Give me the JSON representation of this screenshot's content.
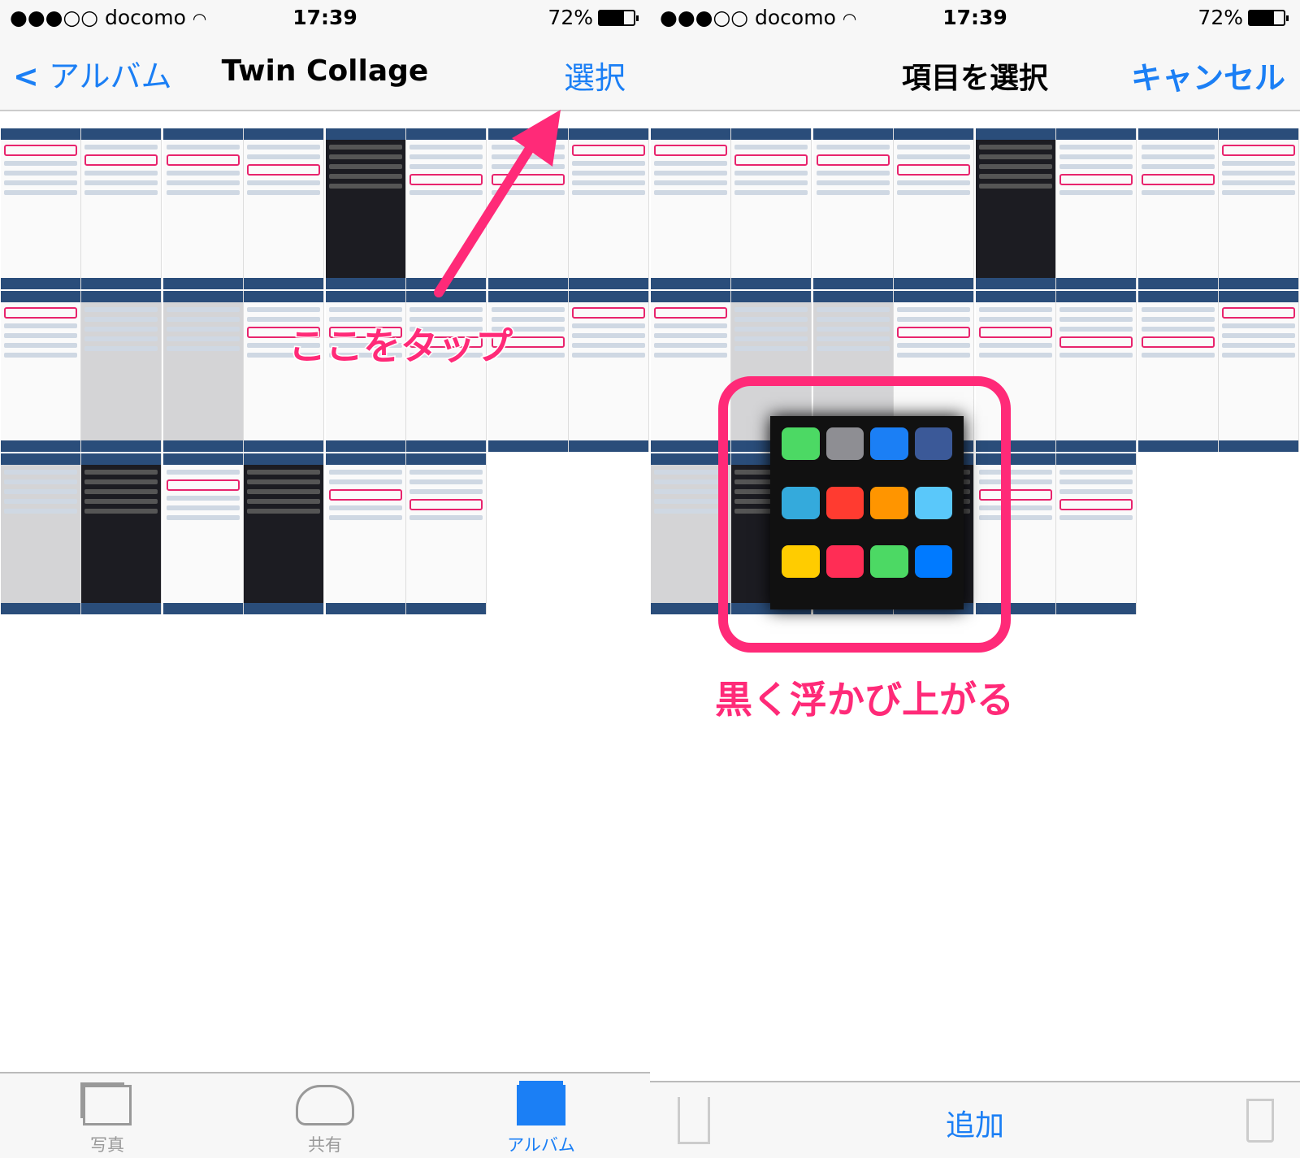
{
  "status": {
    "carrier": "●●●○○ docomo",
    "time": "17:39",
    "battery": "72%",
    "battery_level": 0.72
  },
  "left": {
    "nav": {
      "back": "アルバム",
      "title": "Twin Collage",
      "select": "選択"
    },
    "tabs": [
      {
        "label": "写真",
        "icon": "photos-icon",
        "active": false
      },
      {
        "label": "共有",
        "icon": "cloud-icon",
        "active": false
      },
      {
        "label": "アルバム",
        "icon": "album-icon",
        "active": true
      }
    ],
    "annotation": "ここをタップ"
  },
  "right": {
    "nav": {
      "title": "項目を選択",
      "cancel": "キャンセル"
    },
    "toolbar": {
      "share_icon": "share-icon",
      "add": "追加",
      "trash_icon": "trash-icon"
    },
    "annotation": "黒く浮かび上がる"
  },
  "colors": {
    "accent": "#1b7ff5",
    "annotation": "#ff2a78"
  },
  "thumbnails": [
    [
      "light",
      "light"
    ],
    [
      "light",
      "light"
    ],
    [
      "dark",
      "light"
    ],
    [
      "light",
      "light"
    ],
    [
      "light",
      "gray"
    ],
    [
      "gray",
      "light"
    ],
    [
      "light",
      "light"
    ],
    [
      "light",
      "light"
    ],
    [
      "gray",
      "dark"
    ],
    [
      "light",
      "dark"
    ],
    [
      "light",
      "light"
    ]
  ]
}
